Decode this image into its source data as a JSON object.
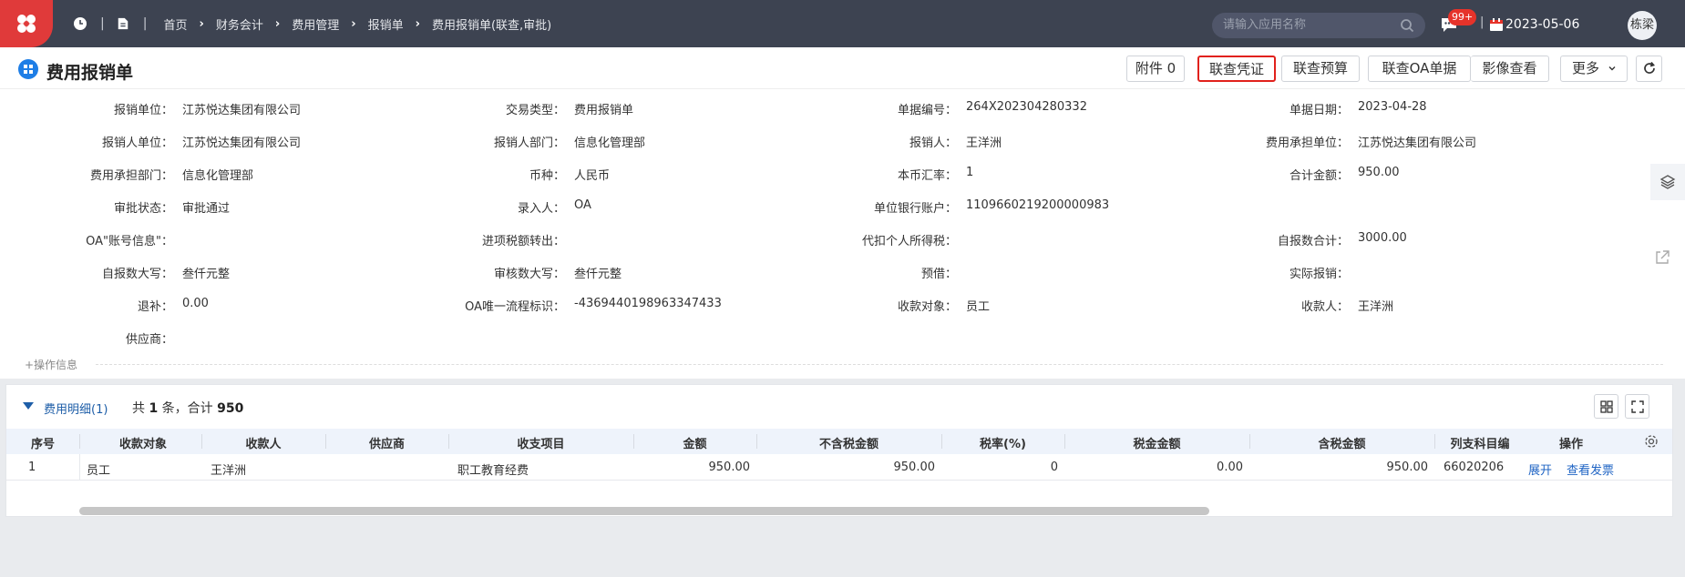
{
  "topbar": {
    "breadcrumbs": [
      "首页",
      "财务会计",
      "费用管理",
      "报销单",
      "费用报销单(联查,审批)"
    ],
    "search_placeholder": "请输入应用名称",
    "message_badge": "99+",
    "date": "2023-05-06",
    "user_avatar": "栋梁"
  },
  "page": {
    "title": "费用报销单",
    "buttons": {
      "attachment": "附件 0",
      "voucher": "联查凭证",
      "budget": "联查预算",
      "oa": "联查OA单据",
      "image": "影像查看",
      "more": "更多"
    }
  },
  "form": {
    "rows": [
      [
        {
          "label": "报销单位：",
          "value": "江苏悦达集团有限公司"
        },
        {
          "label": "交易类型：",
          "value": "费用报销单"
        },
        {
          "label": "单据编号：",
          "value": "264X202304280332"
        },
        {
          "label": "单据日期：",
          "value": "2023-04-28"
        }
      ],
      [
        {
          "label": "报销人单位：",
          "value": "江苏悦达集团有限公司"
        },
        {
          "label": "报销人部门：",
          "value": "信息化管理部"
        },
        {
          "label": "报销人：",
          "value": "王洋洲"
        },
        {
          "label": "费用承担单位：",
          "value": "江苏悦达集团有限公司"
        }
      ],
      [
        {
          "label": "费用承担部门：",
          "value": "信息化管理部"
        },
        {
          "label": "币种：",
          "value": "人民币"
        },
        {
          "label": "本币汇率：",
          "value": "1"
        },
        {
          "label": "合计金额：",
          "value": "950.00"
        }
      ],
      [
        {
          "label": "审批状态：",
          "value": "审批通过"
        },
        {
          "label": "录入人：",
          "value": "OA"
        },
        {
          "label": "单位银行账户：",
          "value": "1109660219200000983"
        },
        {
          "label": "",
          "value": ""
        }
      ],
      [
        {
          "label": "OA\"账号信息\"：",
          "value": ""
        },
        {
          "label": "进项税额转出：",
          "value": ""
        },
        {
          "label": "代扣个人所得税：",
          "value": ""
        },
        {
          "label": "自报数合计：",
          "value": "3000.00"
        }
      ],
      [
        {
          "label": "自报数大写：",
          "value": "叁仟元整"
        },
        {
          "label": "审核数大写：",
          "value": "叁仟元整"
        },
        {
          "label": "预借：",
          "value": ""
        },
        {
          "label": "实际报销：",
          "value": ""
        }
      ],
      [
        {
          "label": "退补：",
          "value": "0.00"
        },
        {
          "label": "OA唯一流程标识：",
          "value": "-4369440198963347433"
        },
        {
          "label": "收款对象：",
          "value": "员工"
        },
        {
          "label": "收款人：",
          "value": "王洋洲"
        }
      ],
      [
        {
          "label": "供应商：",
          "value": ""
        },
        {
          "label": "",
          "value": ""
        },
        {
          "label": "",
          "value": ""
        },
        {
          "label": "",
          "value": ""
        }
      ]
    ],
    "op_info": "+操作信息"
  },
  "detail": {
    "title": "费用明细(1)",
    "count_prefix": "共",
    "count": "1",
    "count_mid": "条，合计",
    "total": "950",
    "columns": [
      "序号",
      "收款对象",
      "收款人",
      "供应商",
      "收支项目",
      "金额",
      "不含税金额",
      "税率(%)",
      "税金金额",
      "含税金额",
      "列支科目编",
      "操作"
    ],
    "rows": [
      {
        "no": "1",
        "payee_type": "员工",
        "payee": "王洋洲",
        "supplier": "",
        "item": "职工教育经费",
        "amount": "950.00",
        "amount_ex_tax": "950.00",
        "tax_rate": "0",
        "tax_amount": "0.00",
        "amount_in_tax": "950.00",
        "account_code": "66020206",
        "action_expand": "展开",
        "action_invoice": "查看发票"
      }
    ]
  }
}
